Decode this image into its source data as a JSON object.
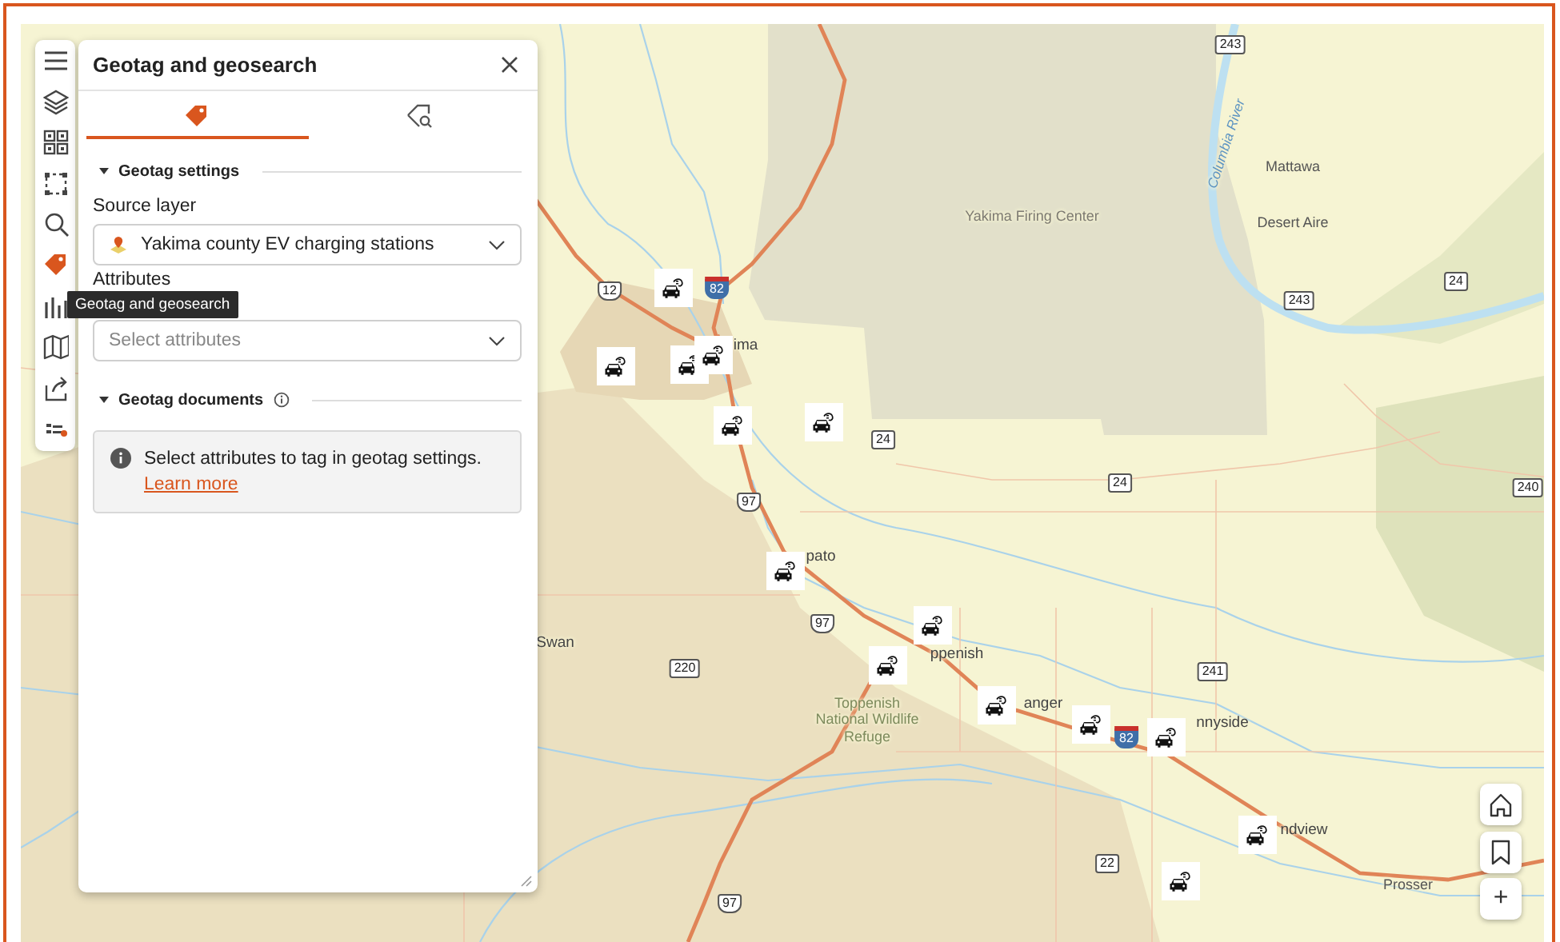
{
  "map": {
    "labels": [
      {
        "kind": "area",
        "text": "Yakima Firing Center"
      },
      {
        "kind": "place",
        "text": "Mattawa"
      },
      {
        "kind": "place",
        "text": "Desert Aire"
      },
      {
        "kind": "water",
        "text": "Columbia River"
      },
      {
        "kind": "city",
        "text": "ima"
      },
      {
        "kind": "city",
        "text": "pato"
      },
      {
        "kind": "city",
        "text": "ppenish"
      },
      {
        "kind": "city",
        "text": "anger"
      },
      {
        "kind": "city",
        "text": "nnyside"
      },
      {
        "kind": "city",
        "text": "ndview"
      },
      {
        "kind": "place",
        "text": "Prosser"
      },
      {
        "kind": "city",
        "text": "Swan"
      },
      {
        "kind": "refuge",
        "text": "Toppenish National Wildlife Refuge"
      }
    ],
    "shields": [
      {
        "kind": "state",
        "text": "243"
      },
      {
        "kind": "state",
        "text": "243"
      },
      {
        "kind": "state",
        "text": "24"
      },
      {
        "kind": "us",
        "text": "12"
      },
      {
        "kind": "interstate",
        "text": "82"
      },
      {
        "kind": "state",
        "text": "24"
      },
      {
        "kind": "state",
        "text": "24"
      },
      {
        "kind": "us",
        "text": "97"
      },
      {
        "kind": "us",
        "text": "97"
      },
      {
        "kind": "state",
        "text": "220"
      },
      {
        "kind": "state",
        "text": "241"
      },
      {
        "kind": "state",
        "text": "22"
      },
      {
        "kind": "us",
        "text": "97"
      },
      {
        "kind": "interstate",
        "text": "82"
      },
      {
        "kind": "state",
        "text": "240"
      }
    ],
    "controls": [
      {
        "kind": "home"
      },
      {
        "kind": "bookmark"
      },
      {
        "kind": "zoom-in",
        "text": "+"
      }
    ]
  },
  "toolbar": {
    "items": [
      {
        "kind": "menu",
        "selected": false
      },
      {
        "kind": "layers",
        "selected": false
      },
      {
        "kind": "grid",
        "selected": false
      },
      {
        "kind": "select",
        "selected": false
      },
      {
        "kind": "search",
        "selected": false
      },
      {
        "kind": "geotag",
        "selected": true
      },
      {
        "kind": "chart",
        "selected": false
      },
      {
        "kind": "map",
        "selected": false
      },
      {
        "kind": "share",
        "selected": false
      },
      {
        "kind": "legend",
        "selected": false
      }
    ]
  },
  "tooltip": "Geotag and geosearch",
  "panel": {
    "title": "Geotag and geosearch",
    "tabs": [
      {
        "kind": "geotag",
        "selected": true
      },
      {
        "kind": "geosearch",
        "selected": false
      }
    ],
    "sections": [
      {
        "kind": "settings",
        "title": "Geotag settings",
        "expanded": true,
        "fields": [
          {
            "label": "Source layer",
            "value": "Yakima county EV charging stations"
          },
          {
            "label": "Attributes",
            "placeholder": "Select attributes"
          }
        ]
      },
      {
        "kind": "documents",
        "title": "Geotag documents",
        "expanded": true,
        "info": {
          "text": "Select attributes to tag in geotag settings.",
          "link": "Learn more"
        }
      }
    ]
  }
}
